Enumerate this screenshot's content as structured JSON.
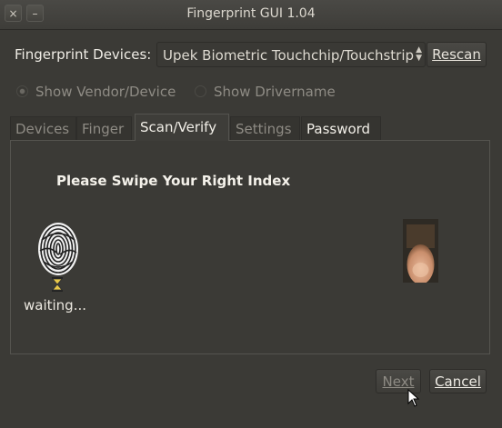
{
  "window": {
    "title": "Fingerprint GUI 1.04",
    "close_glyph": "×",
    "minimize_glyph": "–"
  },
  "devices": {
    "label": "Fingerprint Devices:",
    "selected": "Upek Biometric Touchchip/Touchstrip",
    "rescan_label": "Rescan"
  },
  "display_options": [
    {
      "label": "Show Vendor/Device",
      "selected": true
    },
    {
      "label": "Show Drivername",
      "selected": false
    }
  ],
  "tabs": [
    {
      "label": "Devices",
      "active": false
    },
    {
      "label": "Finger",
      "active": false
    },
    {
      "label": "Scan/Verify",
      "active": true
    },
    {
      "label": "Settings",
      "active": false
    },
    {
      "label": "Password",
      "active": false
    }
  ],
  "scan": {
    "instruction": "Please Swipe Your Right Index",
    "status": "waiting..."
  },
  "buttons": {
    "next_label": "Next",
    "cancel_label": "Cancel"
  },
  "icons": {
    "fingerprint": "fingerprint-icon",
    "hourglass": "hourglass-icon",
    "finger_photo": "finger-image",
    "cursor": "mouse-cursor"
  }
}
